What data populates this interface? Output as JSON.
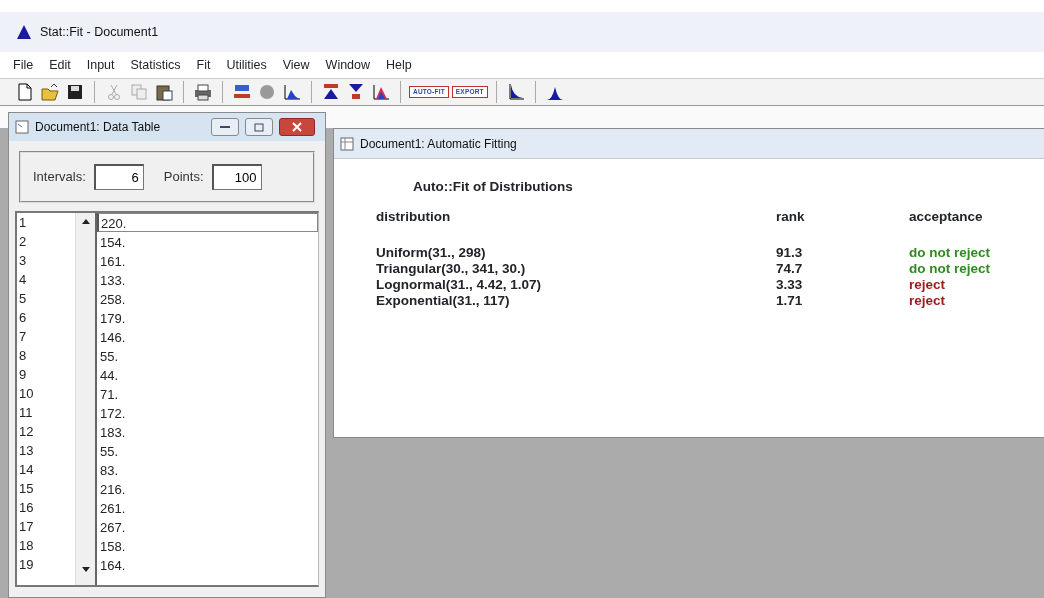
{
  "window": {
    "title": "Stat::Fit - Document1"
  },
  "menu": [
    "File",
    "Edit",
    "Input",
    "Statistics",
    "Fit",
    "Utilities",
    "View",
    "Window",
    "Help"
  ],
  "toolbar_labels": [
    "AUTO-FIT",
    "EXPORT"
  ],
  "data_window": {
    "title": "Document1: Data Table",
    "intervals_label": "Intervals:",
    "intervals": "6",
    "points_label": "Points:",
    "points": "100",
    "rows": [
      {
        "index": "1",
        "value": "220.",
        "selected": true
      },
      {
        "index": "2",
        "value": "154.",
        "selected": false
      },
      {
        "index": "3",
        "value": "161.",
        "selected": false
      },
      {
        "index": "4",
        "value": "133.",
        "selected": false
      },
      {
        "index": "5",
        "value": "258.",
        "selected": false
      },
      {
        "index": "6",
        "value": "179.",
        "selected": false
      },
      {
        "index": "7",
        "value": "146.",
        "selected": false
      },
      {
        "index": "8",
        "value": "55.",
        "selected": false
      },
      {
        "index": "9",
        "value": "44.",
        "selected": false
      },
      {
        "index": "10",
        "value": "71.",
        "selected": false
      },
      {
        "index": "11",
        "value": "172.",
        "selected": false
      },
      {
        "index": "12",
        "value": "183.",
        "selected": false
      },
      {
        "index": "13",
        "value": "55.",
        "selected": false
      },
      {
        "index": "14",
        "value": "83.",
        "selected": false
      },
      {
        "index": "15",
        "value": "216.",
        "selected": false
      },
      {
        "index": "16",
        "value": "261.",
        "selected": false
      },
      {
        "index": "17",
        "value": "267.",
        "selected": false
      },
      {
        "index": "18",
        "value": "158.",
        "selected": false
      },
      {
        "index": "19",
        "value": "164.",
        "selected": false
      }
    ]
  },
  "fit_window": {
    "title": "Document1: Automatic Fitting",
    "heading": "Auto::Fit of Distributions",
    "columns": [
      "distribution",
      "rank",
      "acceptance"
    ],
    "rows": [
      {
        "distribution": "Uniform(31., 298)",
        "rank": "91.3",
        "acceptance": "do not reject",
        "kind": "pass"
      },
      {
        "distribution": "Triangular(30., 341, 30.)",
        "rank": "74.7",
        "acceptance": "do not reject",
        "kind": "pass"
      },
      {
        "distribution": "Lognormal(31., 4.42, 1.07)",
        "rank": "3.33",
        "acceptance": "reject",
        "kind": "fail"
      },
      {
        "distribution": "Exponential(31., 117)",
        "rank": "1.71",
        "acceptance": "reject",
        "kind": "fail"
      }
    ]
  }
}
